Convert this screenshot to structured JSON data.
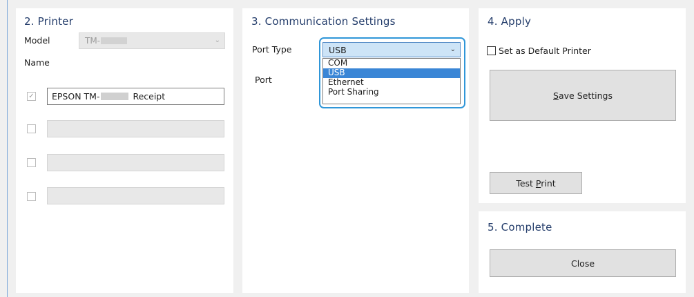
{
  "printer": {
    "title": "2. Printer",
    "model_label": "Model",
    "model_value": "TM-",
    "name_label": "Name",
    "name_prefix": "EPSON TM-",
    "name_suffix": "Receipt",
    "slots": [
      {
        "checked": true,
        "enabled": true
      },
      {
        "checked": false,
        "enabled": false
      },
      {
        "checked": false,
        "enabled": false
      },
      {
        "checked": false,
        "enabled": false
      }
    ]
  },
  "communication": {
    "title": "3. Communication Settings",
    "port_type_label": "Port Type",
    "port_label": "Port",
    "port_type_value": "USB",
    "options": [
      "COM",
      "USB",
      "Ethernet",
      "Port Sharing"
    ],
    "selected_option": "USB"
  },
  "apply": {
    "title": "4. Apply",
    "default_printer_label": "Set as Default Printer",
    "default_printer_checked": false,
    "save_first": "S",
    "save_rest": "ave Settings",
    "test_prefix": "Test ",
    "test_first": "P",
    "test_rest": "rint"
  },
  "complete": {
    "title": "5. Complete",
    "close_label": "Close"
  },
  "colors": {
    "panel": "#ffffff",
    "background": "#f0f0f0",
    "title": "#243d6b",
    "highlight": "#2f96d8",
    "selection": "#3a86d6"
  }
}
